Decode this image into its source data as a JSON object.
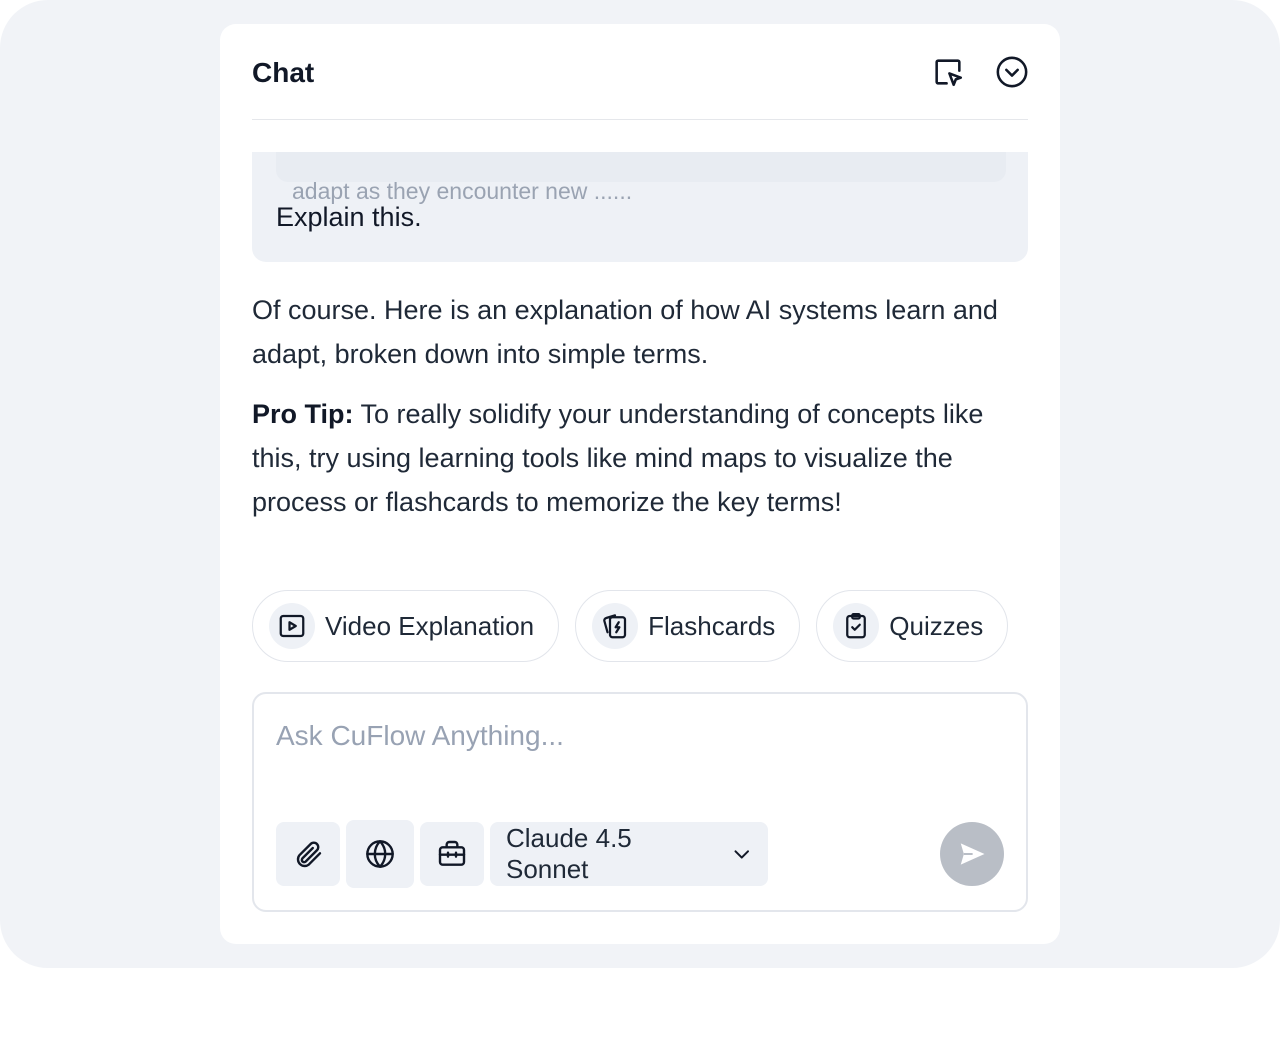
{
  "header": {
    "title": "Chat"
  },
  "conversation": {
    "quoted_excerpt": "adapt as they encounter new ......",
    "user_message": "Explain this.",
    "assistant_intro": "Of course. Here is an explanation of how AI systems learn and adapt, broken down into simple terms.",
    "pro_tip_label": "Pro Tip:",
    "pro_tip_text": " To really solidify your understanding of concepts like this, try using learning tools like mind maps to visualize the process or flashcards to memorize the key terms!"
  },
  "suggestions": [
    {
      "label": "Video Explanation",
      "icon": "video-play-icon"
    },
    {
      "label": "Flashcards",
      "icon": "flashcards-icon"
    },
    {
      "label": "Quizzes",
      "icon": "clipboard-check-icon"
    }
  ],
  "composer": {
    "placeholder": "Ask CuFlow Anything...",
    "value": "",
    "model_label": "Claude 4.5 Sonnet",
    "tools": [
      "paperclip-icon",
      "globe-icon",
      "briefcase-icon"
    ]
  },
  "colors": {
    "backdrop": "#f1f3f7",
    "panel": "#ffffff",
    "bubble": "#eef1f6",
    "send_disabled": "#b9bec6",
    "text": "#111827"
  }
}
